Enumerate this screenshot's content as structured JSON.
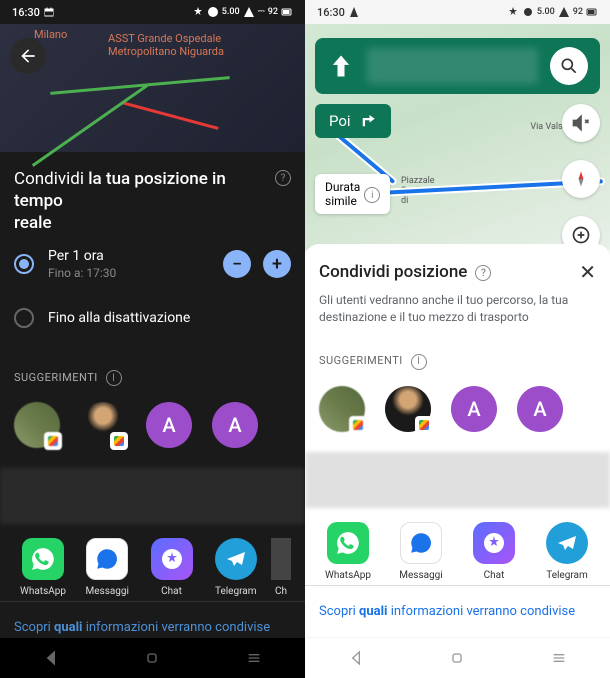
{
  "status": {
    "time": "16:30",
    "battery": "92"
  },
  "left": {
    "map_labels": {
      "milano": "Milano",
      "hospital": "ASST Grande Ospedale\nMetropolitano Niguarda"
    },
    "title_pre": "Condividi ",
    "title_bold": "la tua posizione in tempo\nreale",
    "options": {
      "o1_label": "Per 1 ora",
      "o1_sub": "Fino a: 17:30",
      "o2_label": "Fino alla disattivazione"
    },
    "suggestions_label": "SUGGERIMENTI",
    "avatar_letter": "A",
    "apps": {
      "a1": "WhatsApp",
      "a2": "Messaggi",
      "a3": "Chat",
      "a4": "Telegram",
      "a5": "Ch"
    },
    "footer_pre": "Scopri ",
    "footer_bold": "quali",
    "footer_post": " informazioni verranno condivise"
  },
  "right": {
    "poi_label": "Poi",
    "durata_label": "Durata\nsimile",
    "map_labels": {
      "valsolda": "Via Valsolda",
      "piazzale": "Piazzale\nSantorre\ndi"
    },
    "sheet_title": "Condividi posizione",
    "sheet_desc": "Gli utenti vedranno anche il tuo percorso, la tua destinazione e il tuo mezzo di trasporto",
    "suggestions_label": "SUGGERIMENTI",
    "apps": {
      "a1": "WhatsApp",
      "a2": "Messaggi",
      "a3": "Chat",
      "a4": "Telegram"
    },
    "footer_pre": "Scopri ",
    "footer_bold": "quali",
    "footer_post": " informazioni verranno condivise"
  }
}
